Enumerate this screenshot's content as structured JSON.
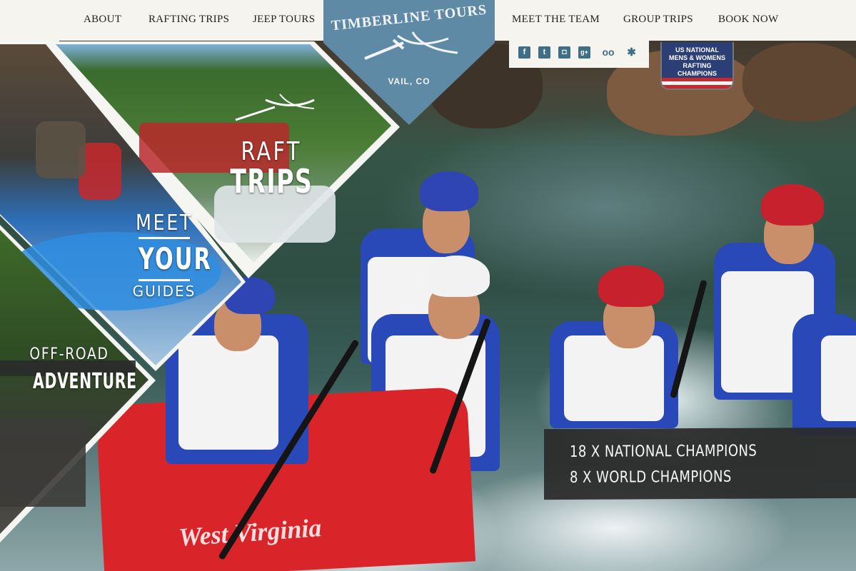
{
  "nav": {
    "left": [
      {
        "label": "ABOUT"
      },
      {
        "label": "RAFTING TRIPS"
      },
      {
        "label": "JEEP TOURS"
      }
    ],
    "right": [
      {
        "label": "MEET THE TEAM"
      },
      {
        "label": "GROUP TRIPS"
      },
      {
        "label": "BOOK NOW"
      }
    ]
  },
  "logo": {
    "title": "TIMBERLINE TOURS",
    "subtitle": "VAIL, CO",
    "color": "#5f8aa6"
  },
  "social": [
    {
      "icon": "facebook-icon",
      "glyph": "f"
    },
    {
      "icon": "twitter-icon",
      "glyph": "t"
    },
    {
      "icon": "instagram-icon",
      "glyph": "◘"
    },
    {
      "icon": "google-plus-icon",
      "glyph": "g+"
    },
    {
      "icon": "tripadvisor-icon",
      "glyph": "oo"
    },
    {
      "icon": "yelp-icon",
      "glyph": "✱"
    }
  ],
  "shield": {
    "text": "US NATIONAL\nMENS & WOMENS\nRAFTING\nCHAMPIONS"
  },
  "panels": {
    "raft": {
      "line1": "RAFT",
      "line2": "TRIPS"
    },
    "guides": {
      "line1": "MEET",
      "line2": "YOUR",
      "line3": "GUIDES"
    },
    "offroad": {
      "line1": "OFF-ROAD",
      "line2": "ADVENTURE"
    }
  },
  "hero": {
    "raft_print": "West Virginia"
  },
  "banner": {
    "line1": "18 X NATIONAL CHAMPIONS",
    "line2": "8 X WORLD CHAMPIONS"
  },
  "colors": {
    "nav_bg": "#f5f4ef",
    "brand_blue": "#5f8aa6",
    "raft_red": "#d9252a"
  }
}
